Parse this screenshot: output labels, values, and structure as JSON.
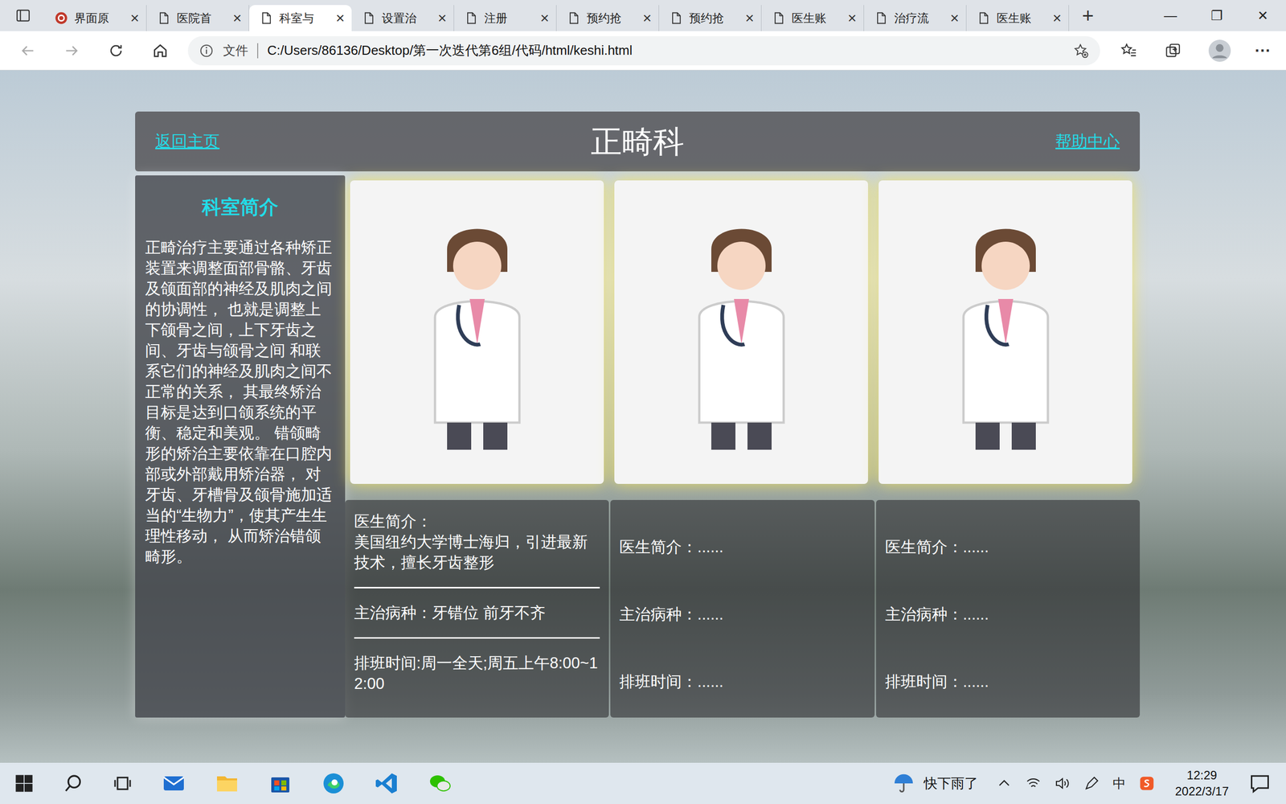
{
  "browser": {
    "tabs": [
      {
        "label": "界面原",
        "selected": false,
        "kind": "logo"
      },
      {
        "label": "医院首",
        "selected": false,
        "kind": "doc"
      },
      {
        "label": "科室与",
        "selected": true,
        "kind": "doc"
      },
      {
        "label": "设置治",
        "selected": false,
        "kind": "doc"
      },
      {
        "label": "注册",
        "selected": false,
        "kind": "doc"
      },
      {
        "label": "预约抢",
        "selected": false,
        "kind": "doc"
      },
      {
        "label": "预约抢",
        "selected": false,
        "kind": "doc"
      },
      {
        "label": "医生账",
        "selected": false,
        "kind": "doc"
      },
      {
        "label": "治疗流",
        "selected": false,
        "kind": "doc"
      },
      {
        "label": "医生账",
        "selected": false,
        "kind": "doc"
      }
    ],
    "close": "×",
    "new_tab": "+",
    "controls": [
      "—",
      "❐",
      "✕"
    ]
  },
  "address": {
    "scheme": "文件",
    "url": "C:/Users/86136/Desktop/第一次迭代第6组/代码/html/keshi.html",
    "more": "···"
  },
  "page": {
    "back": "返回主页",
    "title": "正畸科",
    "help": "帮助中心",
    "sidebar": {
      "title": "科室简介",
      "text": "正畸治疗主要通过各种矫正装置来调整面部骨骼、牙齿及颌面部的神经及肌肉之间的协调性， 也就是调整上下颌骨之间，上下牙齿之间、牙齿与颌骨之间 和联系它们的神经及肌肉之间不正常的关系， 其最终矫治目标是达到口颌系统的平衡、稳定和美观。 错颌畸形的矫治主要依靠在口腔内部或外部戴用矫治器， 对牙齿、牙槽骨及颌骨施加适当的“生物力”，使其产生生理性移动， 从而矫治错颌畸形。"
    },
    "doctors": [
      {
        "intro": "医生简介：\n美国纽约大学博士海归，引进最新技术，擅长牙齿整形",
        "disease": "主治病种：牙错位 前牙不齐",
        "schedule": "排班时间:周一全天;周五上午8:00~12:00",
        "dividers": true
      },
      {
        "intro": "医生简介：......",
        "disease": "主治病种：......",
        "schedule": "排班时间：......",
        "dividers": false
      },
      {
        "intro": "医生简介：......",
        "disease": "主治病种：......",
        "schedule": "排班时间：......",
        "dividers": false
      }
    ]
  },
  "taskbar": {
    "weather": "快下雨了",
    "ime": "中",
    "time": "12:29",
    "date": "2022/3/17"
  }
}
